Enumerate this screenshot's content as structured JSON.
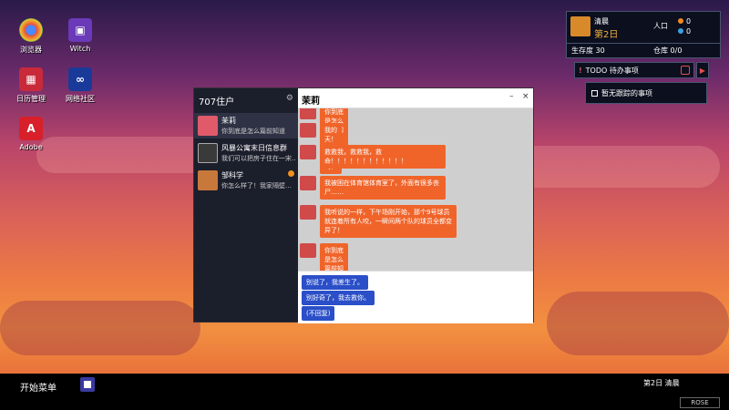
{
  "desktop": {
    "icons": [
      {
        "label": "浏览器",
        "icon": "browser-icon"
      },
      {
        "label": "Witch",
        "icon": "twitch-icon"
      },
      {
        "label": "日历管理",
        "icon": "calendar-icon"
      },
      {
        "label": "网络社区",
        "icon": "network-icon"
      },
      {
        "label": "Adobe",
        "icon": "adobe-icon"
      }
    ]
  },
  "status": {
    "role": "清晨",
    "day": "第2日",
    "population_label": "人口",
    "population_orange": "0",
    "population_blue": "0",
    "survival_label": "生存度",
    "survival_value": "30",
    "warehouse_label": "仓库",
    "warehouse_value": "0/0"
  },
  "todo": {
    "label": "TODO 待办事项",
    "item": "暂无跟踪的事项"
  },
  "chat": {
    "sidebar_title": "707住户",
    "contacts": [
      {
        "name": "茉莉",
        "preview": "你到底是怎么篇前知道"
      },
      {
        "name": "风暴公寓末日信息群",
        "preview": "我们可以把房子住在一宋…"
      },
      {
        "name": "邹科学",
        "preview": "你怎么样了！我家隔壁…"
      }
    ],
    "header_name": "茉莉",
    "messages": [
      "你到底是怎么篇前知道的？！",
      "我的天！你还活着吗？",
      "救救我，救救我，救命！！！！！！！！！！！！",
      "我被困在体育馆体育室了，外面有很多丧尸……",
      "我听说的一样，下午场刚开始，那个9号球员就连着所有人咬，一瞬间两个队的球员全都变异了！",
      "你到底是怎么篇前知道的？！"
    ],
    "options": [
      "别说了，我差生了。",
      "别好奇了，我去救你。",
      "(不回复)"
    ]
  },
  "taskbar": {
    "start_label": "开始菜单",
    "time_label": "第2日 清晨",
    "sys_label": "ROSE"
  }
}
